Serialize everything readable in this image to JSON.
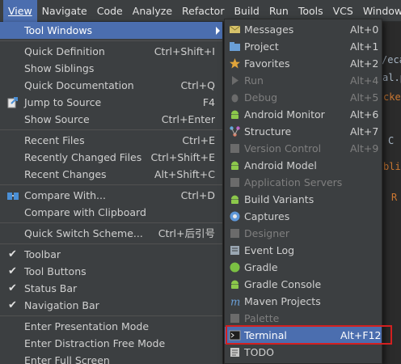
{
  "menubar": {
    "items": [
      "View",
      "Navigate",
      "Code",
      "Analyze",
      "Refactor",
      "Build",
      "Run",
      "Tools",
      "VCS",
      "Window"
    ]
  },
  "editor": {
    "snippets": [
      "/eca",
      "al.p",
      "cke",
      "C",
      "bli",
      "R"
    ]
  },
  "view_menu": {
    "items": [
      {
        "label": "Tool Windows",
        "shortcut": ""
      },
      {
        "label": "Quick Definition",
        "shortcut": "Ctrl+Shift+I"
      },
      {
        "label": "Show Siblings",
        "shortcut": ""
      },
      {
        "label": "Quick Documentation",
        "shortcut": "Ctrl+Q"
      },
      {
        "label": "Jump to Source",
        "shortcut": "F4"
      },
      {
        "label": "Show Source",
        "shortcut": "Ctrl+Enter"
      },
      {
        "label": "Recent Files",
        "shortcut": "Ctrl+E"
      },
      {
        "label": "Recently Changed Files",
        "shortcut": "Ctrl+Shift+E"
      },
      {
        "label": "Recent Changes",
        "shortcut": "Alt+Shift+C"
      },
      {
        "label": "Compare With...",
        "shortcut": "Ctrl+D"
      },
      {
        "label": "Compare with Clipboard",
        "shortcut": ""
      },
      {
        "label": "Quick Switch Scheme...",
        "shortcut": "Ctrl+后引号"
      },
      {
        "label": "Toolbar",
        "shortcut": ""
      },
      {
        "label": "Tool Buttons",
        "shortcut": ""
      },
      {
        "label": "Status Bar",
        "shortcut": ""
      },
      {
        "label": "Navigation Bar",
        "shortcut": ""
      },
      {
        "label": "Enter Presentation Mode",
        "shortcut": ""
      },
      {
        "label": "Enter Distraction Free Mode",
        "shortcut": ""
      },
      {
        "label": "Enter Full Screen",
        "shortcut": ""
      }
    ]
  },
  "tool_windows": {
    "items": [
      {
        "label": "Messages",
        "shortcut": "Alt+0",
        "icon": "messages-icon",
        "color": "#d6c26a"
      },
      {
        "label": "Project",
        "shortcut": "Alt+1",
        "icon": "project-icon",
        "color": "#6a9fd6"
      },
      {
        "label": "Favorites",
        "shortcut": "Alt+2",
        "icon": "star-icon",
        "color": "#e0a43a"
      },
      {
        "label": "Run",
        "shortcut": "Alt+4",
        "icon": "run-icon",
        "color": "#6b6b6b"
      },
      {
        "label": "Debug",
        "shortcut": "Alt+5",
        "icon": "debug-icon",
        "color": "#6b6b6b"
      },
      {
        "label": "Android Monitor",
        "shortcut": "Alt+6",
        "icon": "android-icon",
        "color": "#8cc84b"
      },
      {
        "label": "Structure",
        "shortcut": "Alt+7",
        "icon": "structure-icon",
        "color": "#c05dc8"
      },
      {
        "label": "Version Control",
        "shortcut": "Alt+9",
        "icon": "version-control-icon",
        "color": "#6b6b6b"
      },
      {
        "label": "Android Model",
        "shortcut": "",
        "icon": "android-icon",
        "color": "#8cc84b"
      },
      {
        "label": "Application Servers",
        "shortcut": "",
        "icon": "server-icon",
        "color": "#6b6b6b"
      },
      {
        "label": "Build Variants",
        "shortcut": "",
        "icon": "android-icon",
        "color": "#8cc84b"
      },
      {
        "label": "Captures",
        "shortcut": "",
        "icon": "captures-icon",
        "color": "#5e97d8"
      },
      {
        "label": "Designer",
        "shortcut": "",
        "icon": "designer-icon",
        "color": "#6b6b6b"
      },
      {
        "label": "Event Log",
        "shortcut": "",
        "icon": "event-log-icon",
        "color": "#9aa7b3"
      },
      {
        "label": "Gradle",
        "shortcut": "",
        "icon": "gradle-icon",
        "color": "#7bc043"
      },
      {
        "label": "Gradle Console",
        "shortcut": "",
        "icon": "android-icon",
        "color": "#8cc84b"
      },
      {
        "label": "Maven Projects",
        "shortcut": "",
        "icon": "maven-icon",
        "color": "#6a9fd6"
      },
      {
        "label": "Palette",
        "shortcut": "",
        "icon": "palette-icon",
        "color": "#6b6b6b"
      },
      {
        "label": "Terminal",
        "shortcut": "Alt+F12",
        "icon": "terminal-icon",
        "color": "#1e1e1e"
      },
      {
        "label": "TODO",
        "shortcut": "",
        "icon": "todo-icon",
        "color": "#c7c7c7"
      }
    ]
  },
  "colors": {
    "highlight": "#4b6eaf",
    "callout_border": "#d32020"
  }
}
